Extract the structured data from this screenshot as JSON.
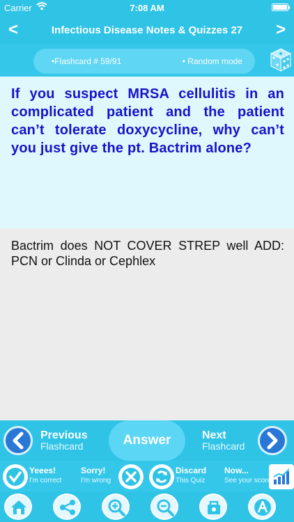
{
  "status": {
    "carrier": "Carrier",
    "time": "7:08 AM"
  },
  "nav": {
    "title": "Infectious Disease Notes & Quizzes 27",
    "back": "<",
    "forward": ">"
  },
  "card": {
    "counter": "•Flashcard #  59/91",
    "mode": "• Random mode"
  },
  "question": "If you suspect MRSA cellulitis in an complicated patient and the patient can’t tolerate doxycycline, why can’t you just give the pt. Bactrim alone?",
  "answer": "Bactrim does NOT COVER STREP well ADD: PCN or Clinda or Cephlex",
  "bottom_nav": {
    "previous_a": "Previous",
    "previous_b": "Flashcard",
    "answer": "Answer",
    "next_a": "Next",
    "next_b": "Flashcard"
  },
  "actions": [
    {
      "t1": "Yeees!",
      "t2": "I'm correct"
    },
    {
      "t1": "Sorry!",
      "t2": "I'm wrong"
    },
    {
      "t1": "Discard",
      "t2": "This Quiz"
    },
    {
      "t1": "Now...",
      "t2": "See your score"
    }
  ],
  "icons": [
    "home-icon",
    "share-icon",
    "zoom-in-icon",
    "zoom-out-icon",
    "bookmark-icon",
    "font-icon"
  ],
  "colors": {
    "accent": "#2fc3e6",
    "question_text": "#1414c8",
    "question_bg": "#dff8fe"
  }
}
